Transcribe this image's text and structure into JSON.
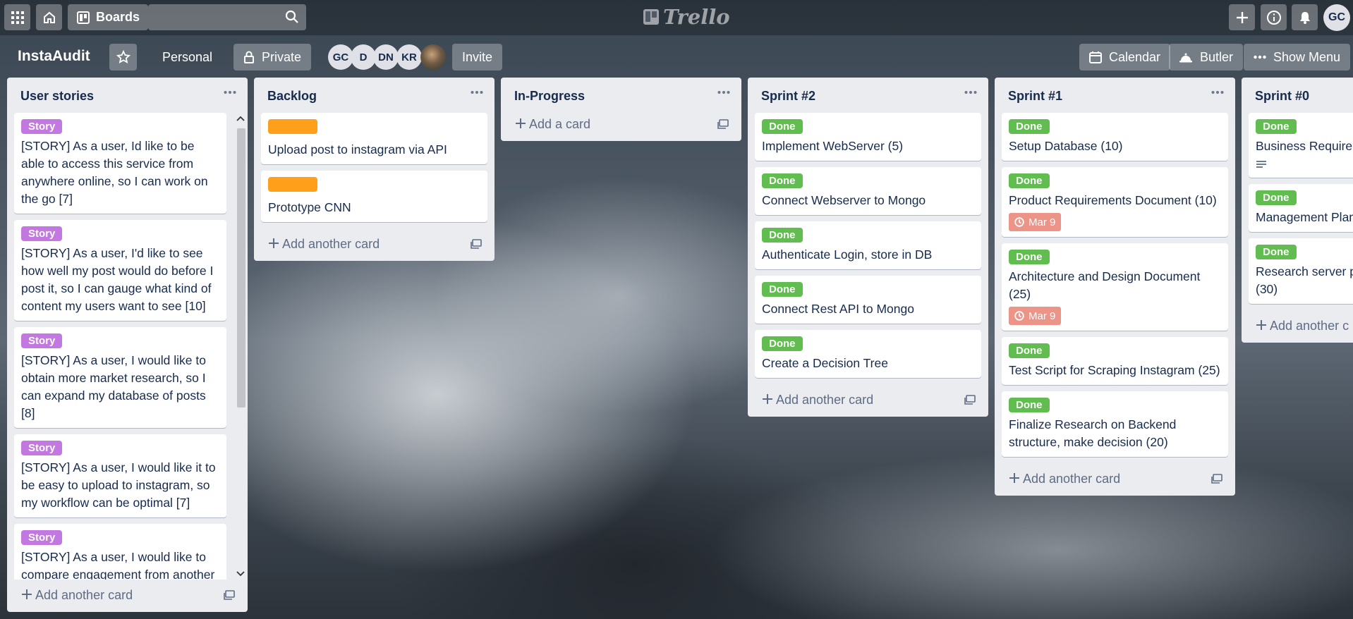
{
  "topbar": {
    "boards_label": "Boards",
    "search_placeholder": "",
    "logo_text": "Trello",
    "user_initials": "GC"
  },
  "board": {
    "title": "InstaAudit",
    "team_label": "Personal",
    "visibility_label": "Private",
    "invite_label": "Invite",
    "calendar_label": "Calendar",
    "butler_label": "Butler",
    "show_menu_label": "Show Menu",
    "members": [
      "GC",
      "D",
      "DN",
      "KR"
    ]
  },
  "lists": {
    "user_stories": {
      "title": "User stories",
      "add_label": "Add another card",
      "cards": [
        {
          "label": "Story",
          "text": "[STORY] As a user, Id like to be able to access this service from anywhere online, so I can work on the go [7]"
        },
        {
          "label": "Story",
          "text": "[STORY] As a user, I'd like to see how well my post would do before I post it, so I can gauge what kind of content my users want to see [10]"
        },
        {
          "label": "Story",
          "text": "[STORY] As a user, I would like to obtain more market research, so I can expand my database of posts [8]"
        },
        {
          "label": "Story",
          "text": "[STORY] As a user, I would like it to be easy to upload to instagram, so my workflow can be optimal [7]"
        },
        {
          "label": "Story",
          "text": "[STORY] As a user, I would like to compare engagement from another"
        }
      ]
    },
    "backlog": {
      "title": "Backlog",
      "add_label": "Add another card",
      "cards": [
        {
          "text": "Upload post to instagram via API"
        },
        {
          "text": "Prototype CNN"
        }
      ]
    },
    "in_progress": {
      "title": "In-Progress",
      "add_label": "Add a card"
    },
    "sprint2": {
      "title": "Sprint #2",
      "add_label": "Add another card",
      "cards": [
        {
          "label": "Done",
          "text": "Implement WebServer (5)"
        },
        {
          "label": "Done",
          "text": "Connect Webserver to Mongo"
        },
        {
          "label": "Done",
          "text": "Authenticate Login, store in DB"
        },
        {
          "label": "Done",
          "text": "Connect Rest API to Mongo"
        },
        {
          "label": "Done",
          "text": "Create a Decision Tree"
        }
      ]
    },
    "sprint1": {
      "title": "Sprint #1",
      "add_label": "Add another card",
      "cards": [
        {
          "label": "Done",
          "text": "Setup Database (10)"
        },
        {
          "label": "Done",
          "text": "Product Requirements Document (10)",
          "due": "Mar 9"
        },
        {
          "label": "Done",
          "text": "Architecture and Design Document (25)",
          "due": "Mar 9"
        },
        {
          "label": "Done",
          "text": "Test Script for Scraping Instagram (25)"
        },
        {
          "label": "Done",
          "text": "Finalize Research on Backend structure, make decision (20)"
        }
      ]
    },
    "sprint0": {
      "title": "Sprint #0",
      "add_label": "Add another c",
      "cards": [
        {
          "label": "Done",
          "text": "Business Requiren"
        },
        {
          "label": "Done",
          "text": "Management Plan"
        },
        {
          "label": "Done",
          "text": "Research server pl (30)"
        }
      ]
    }
  },
  "colors": {
    "story_label": "#c377e0",
    "done_label": "#61bd4f",
    "orange_label": "#ff9f1a",
    "due_badge": "#ec9488",
    "list_bg": "#ebecf0"
  },
  "icons": [
    "apps-icon",
    "home-icon",
    "boards-icon",
    "search-icon",
    "trello-logo-icon",
    "plus-icon",
    "info-icon",
    "bell-icon",
    "star-icon",
    "lock-icon",
    "calendar-icon",
    "butler-icon",
    "more-icon",
    "clock-icon",
    "description-icon",
    "template-icon"
  ]
}
